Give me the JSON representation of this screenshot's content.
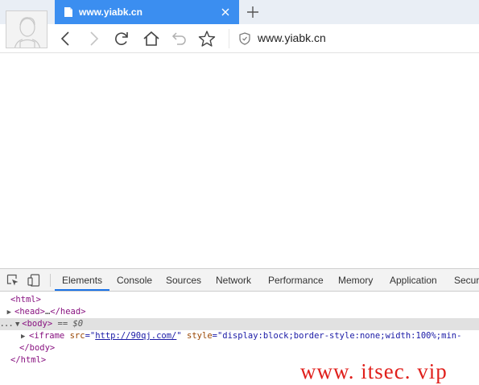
{
  "tab": {
    "title": "www.yiabk.cn"
  },
  "address_bar": {
    "url": "www.yiabk.cn"
  },
  "devtools": {
    "tabs": [
      "Elements",
      "Console",
      "Sources",
      "Network",
      "Performance",
      "Memory",
      "Application",
      "Securi"
    ],
    "active_tab": "Elements",
    "dom": {
      "html_open": "<html>",
      "head_open": "<head>",
      "head_ellipsis": "…",
      "head_close": "</head>",
      "body_prefix": "...",
      "body_open": "<body>",
      "body_marker": " == $0",
      "iframe_open": "<iframe",
      "iframe_src_attr": "src",
      "iframe_src_val": "http://90qj.com/",
      "iframe_style_attr": "style",
      "iframe_style_val": "\"display:block;border-style:none;width:100%;min-",
      "body_close": "</body>",
      "html_close": "</html>"
    }
  },
  "watermark": "www. itsec. vip",
  "colors": {
    "tab_active": "#3b8ef0",
    "tag": "#881280",
    "attr_name": "#994500",
    "attr_value": "#1a1aa6",
    "watermark": "#e0201c"
  },
  "icons": [
    "avatar-icon",
    "page-icon",
    "close-icon",
    "plus-icon",
    "back-icon",
    "forward-icon",
    "reload-icon",
    "home-icon",
    "undo-icon",
    "star-icon",
    "shield-icon",
    "inspect-icon",
    "device-icon"
  ]
}
